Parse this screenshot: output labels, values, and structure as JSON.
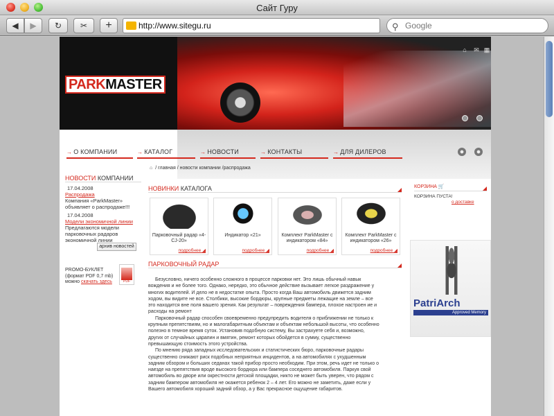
{
  "browser": {
    "window_title": "Сайт Гуру",
    "address": "http://www.sitegu.ru",
    "search_placeholder": "Google"
  },
  "site": {
    "logo_park": "PARK",
    "logo_master": "MASTER",
    "nav": [
      "О КОМПАНИИ",
      "КАТАЛОГ",
      "НОВОСТИ",
      "КОНТАКТЫ",
      "ДЛЯ ДИЛЕРОВ"
    ],
    "breadcrumb": "/ главная / новости компании /распродажа",
    "news_head": {
      "red": "НОВОСТИ",
      "dark": "КОМПАНИИ"
    },
    "news": [
      {
        "date": "17.04.2008",
        "title": "Распродажа",
        "text": "Компания «ParkMaster» объявляет о распродаже!!!"
      },
      {
        "date": "17.04.2008",
        "title": "Модели экономичной линии",
        "text": "Предлагаются модели парковочных радаров экономичной линии"
      }
    ],
    "archive_button": "архив новостей",
    "promo": {
      "line1": "PROMO-БУКЛЕТ",
      "line2": "(формат PDF 0,7 mb)",
      "line3": "можно",
      "link": "скачать здесь",
      "pdf_label": "PDF"
    },
    "catalog_head": {
      "red": "НОВИНКИ",
      "dark": "КАТАЛОГА"
    },
    "catalog": [
      {
        "title": "Парковочный радар «4-CJ-20»",
        "more": "подробнее"
      },
      {
        "title": "Индикатор «21»",
        "more": "подробнее"
      },
      {
        "title": "Комплект ParkMaster с индикатором «84»",
        "more": "подробнее"
      },
      {
        "title": "Комплект ParkMaster с индикатором «26»",
        "more": "подробнее"
      }
    ],
    "article_head": "ПАРКОВОЧНЫЙ РАДАР",
    "article": [
      "Безусловно, ничего особенно сложного в процессе парковки нет. Это лишь обычный навык вождения и не более того. Однако, нередко, это обычное действие вызывает легкое раздражение у многих водителей. И дело не в недостатке опыта. Просто когда Ваш автомобиль движется задним ходом, вы видите не все. Столбики, высокие бордюры, крупные предметы лежащие на земле – все это находится вне поля вашего зрения. Как результат – повреждения бампера, плохое настроен ие и расходы на ремонт",
      "Парковочный радар способен своевременно предупредить водителя о приближении не только к крупным препятствиям, но и малогабаритным объектам и объектам небольшой высоты, что особенно полезно в темное время суток. Установив подобную систему, Вы застрахуете себя и, возможно, других от случайных царапин и вмятин, ремонт которых обойдется в сумму, существенно превышающую стоимость этого устройства.",
      "По мнению ряда западных исследовательских и статистических бюро, парковочные радары существенно снижают риск подобных неприятных инцидентов, а на автомобилях с ухудшенным задним обзором и больших седанах такой прибор просто необходим. При этом, речь идет не только о наезде на препятствия вроде высокого бордюра или бампера соседнего автомобиля. Паркуя свой автомобиль во дворе или окрестности детской площадки, никто не может быть уверен, что рядом с задним бампером автомобиля не окажется ребенок 2 – 4 лет. Его можно не заметить, даже если у Вашего автомобиля хороший задний обзор, а у Вас прекрасное ощущение габаритов."
    ],
    "cart_head": "КОРЗИНА",
    "cart_empty": "КОРЗИНА ПУСТА!",
    "cart_link": "о доставке",
    "ad": {
      "brand": "PatriArch",
      "tagline": "Approved Memory"
    }
  },
  "colors": {
    "accent": "#d4281d",
    "ad_blue": "#2b3f8f"
  }
}
